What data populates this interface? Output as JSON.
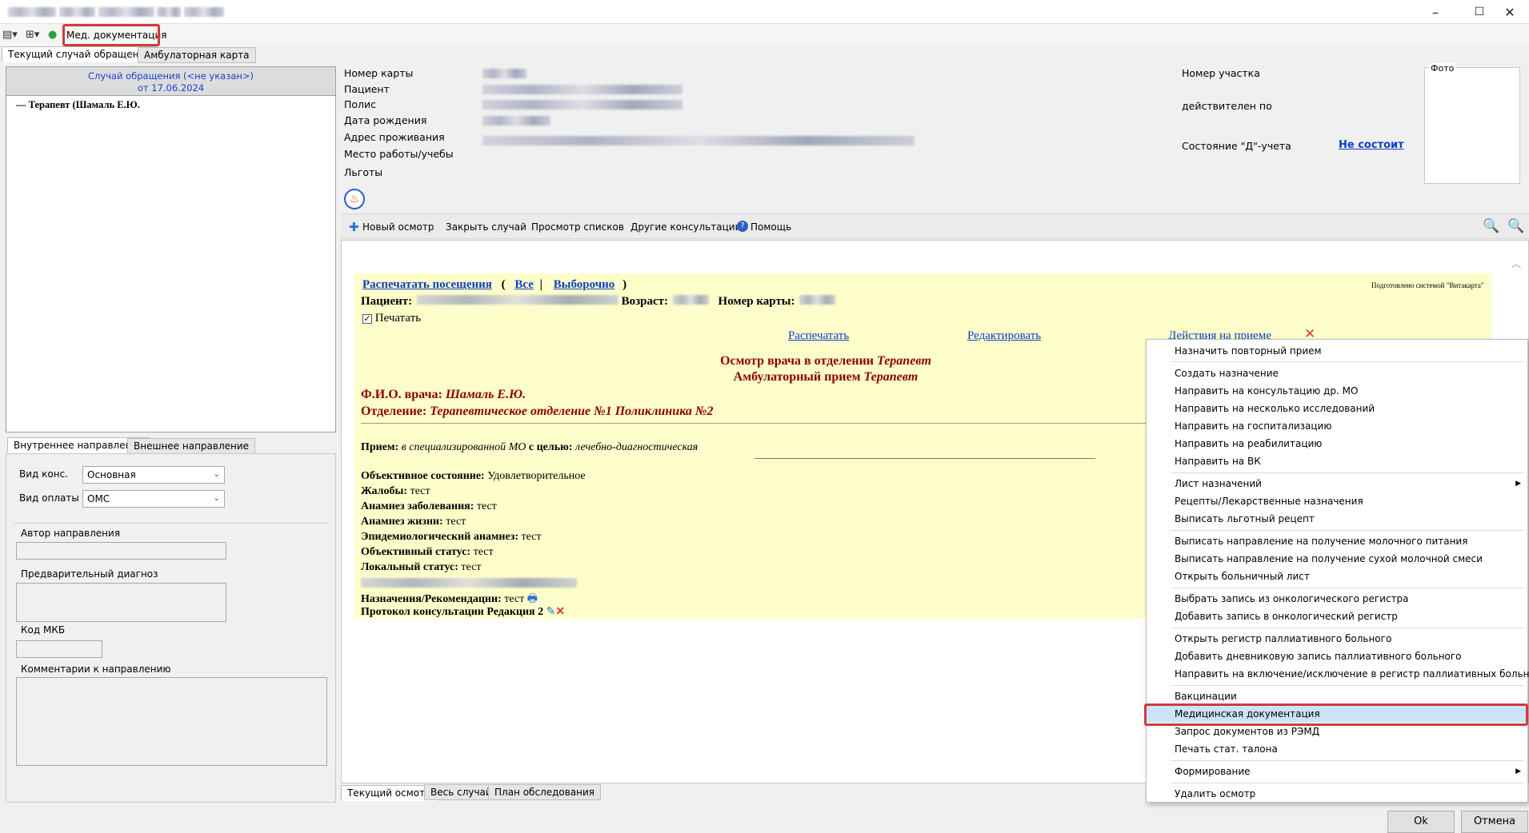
{
  "toolbar": {
    "med_docs_label": "Мед. документация"
  },
  "top_tabs": [
    "Текущий случай обращения",
    "Амбулаторная карта"
  ],
  "case": {
    "title": "Случай обращения (<не указан>)",
    "date": "от 17.06.2024",
    "tree_item": "Терапевт (Шамаль Е.Ю."
  },
  "direction_tabs": [
    "Внутреннее направление",
    "Внешнее направление"
  ],
  "direction_form": {
    "vid_kons_label": "Вид конс.",
    "vid_kons_value": "Основная",
    "vid_oplaty_label": "Вид оплаты",
    "vid_oplaty_value": "ОМС",
    "author_label": "Автор направления",
    "prelim_diag_label": "Предварительный диагноз",
    "mkb_label": "Код МКБ",
    "comments_label": "Комментарии к направлению"
  },
  "patient_fields": [
    "Номер карты",
    "Пациент",
    "Полис",
    "Дата рождения",
    "Адрес проживания",
    "Место работы/учебы",
    "Льготы"
  ],
  "right_fields": {
    "uchastok": "Номер участка",
    "valid_until": "действителен по",
    "d_state": "Состояние \"Д\"-учета",
    "d_state_value": "Не состоит",
    "photo": "Фото"
  },
  "actions_toolbar": [
    "Новый осмотр",
    "Закрыть случай",
    "Просмотр списков",
    "Другие консультации",
    "Помощь"
  ],
  "document": {
    "print_visits": "Распечатать посещения",
    "all": "Все",
    "selective": "Выборочно",
    "prepared_by": "Подготовлено системой \"Витакарта\"",
    "patient_label": "Пациент:",
    "age_label": "Возраст:",
    "card_label": "Номер карты:",
    "print_checkbox": "Печатать",
    "print_link": "Распечатать",
    "edit_link": "Редактировать",
    "actions_link": "Действия на приеме",
    "heading1_prefix": "Осмотр врача в отделении ",
    "heading1_spec": "Терапевт",
    "heading2_prefix": "Амбулаторный прием ",
    "heading2_spec": "Терапевт",
    "doctor_label": "Ф.И.О. врача:",
    "doctor_value": "Шамаль Е.Ю.",
    "dept_label": "Отделение:",
    "dept_value": "Терапевтическое отделение №1 Поликлиника №2",
    "reception_label": "Прием:",
    "reception_where": "в специализированной МО",
    "reception_goal_label": "с целью:",
    "reception_goal": "лечебно-диагностическая",
    "rows": [
      {
        "label": "Объективное состояние:",
        "value": "Удовлетворительное"
      },
      {
        "label": "Жалобы:",
        "value": "тест"
      },
      {
        "label": "Анамнез заболевания:",
        "value": "тест"
      },
      {
        "label": "Анамнез жизни:",
        "value": "тест"
      },
      {
        "label": "Эпидемиологический анамнез:",
        "value": "тест"
      },
      {
        "label": "Объективный статус:",
        "value": "тест"
      },
      {
        "label": "Локальный статус:",
        "value": "тест"
      }
    ],
    "appointments_label": "Назначения/Рекомендации:",
    "appointments_value": "тест",
    "protocol": "Протокол консультации Редакция 2"
  },
  "bottom_tabs": [
    "Текущий осмотр",
    "Весь случай",
    "План обследования"
  ],
  "context_menu": [
    "Назначить повторный прием",
    "Создать назначение",
    "Направить на консультацию др. МО",
    "Направить на несколько исследований",
    "Направить на госпитализацию",
    "Направить на реабилитацию",
    "Направить на ВК",
    "Лист назначений",
    "Рецепты/Лекарственные назначения",
    "Выписать льготный рецепт",
    "Выписать направление на получение молочного питания",
    "Выписать направление на получение сухой молочной смеси",
    "Открыть больничный лист",
    "Выбрать запись из онкологического регистра",
    "Добавить запись в онкологический регистр",
    "Открыть регистр паллиативного больного",
    "Добавить дневниковую запись паллиативного больного",
    "Направить на включение/исключение в регистр паллиативных больных",
    "Вакцинации",
    "Медицинская документация",
    "Запрос документов из РЭМД",
    "Печать стат. талона",
    "Формирование",
    "Удалить осмотр"
  ],
  "buttons": {
    "ok": "Ok",
    "cancel": "Отмена"
  },
  "colors": {
    "accent_red": "#d03b3b",
    "doc_bg": "#fefecb",
    "link": "#0b3fc4",
    "maroon": "#8b0000",
    "menu_highlight": "#cce4f7"
  }
}
